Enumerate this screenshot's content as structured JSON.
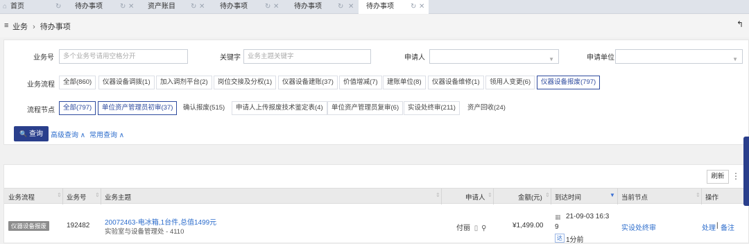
{
  "tabs": [
    {
      "label": "首页",
      "active": false
    },
    {
      "label": "待办事项",
      "active": false
    },
    {
      "label": "资产账目",
      "active": false
    },
    {
      "label": "待办事项",
      "active": false
    },
    {
      "label": "待办事项",
      "active": false
    },
    {
      "label": "待办事项",
      "active": true
    }
  ],
  "breadcrumb": {
    "menu_icon": "≡",
    "root": "业务",
    "separator": "›",
    "current": "待办事项",
    "back_icon": "↰"
  },
  "filters": {
    "business_no": {
      "label": "业务号",
      "placeholder": "多个业务号请用空格分开"
    },
    "keyword": {
      "label": "关键字",
      "placeholder": "业务主题关键字"
    },
    "applicant": {
      "label": "申请人",
      "value": ""
    },
    "unit": {
      "label": "申请单位",
      "value": ""
    }
  },
  "process": {
    "label": "业务流程",
    "chips": [
      "全部(860)",
      "仪器设备调拨(1)",
      "加入调剂平台(2)",
      "岗位交接及分权(1)",
      "仪器设备建账(37)",
      "价值增减(7)",
      "建账单位(8)",
      "仪器设备维修(1)",
      "领用人变更(6)",
      "仪器设备报废(797)"
    ],
    "selected": 9
  },
  "nodes": {
    "label": "流程节点",
    "chips": [
      "全部(797)",
      "单位资产管理员初审(37)",
      "确认报废(515)",
      "申请人上传报废技术鉴定表(4)",
      "单位资产管理员复审(6)",
      "实设处终审(211)",
      "资产回收(24)"
    ],
    "selected": [
      0,
      1
    ]
  },
  "actions": {
    "query": "查询",
    "query_icon": "🔍",
    "advanced": "高级查询 ∧",
    "common": "常用查询 ∧"
  },
  "table": {
    "refresh": "刷新",
    "headers": [
      "业务流程",
      "业务号",
      "业务主题",
      "申请人",
      "金额(元)",
      "到达时间",
      "当前节点",
      "操作"
    ],
    "rows": [
      {
        "flow": "仪器设备报废",
        "no": "192482",
        "title": "20072463-电冰箱,1台件,总值1499元",
        "subtitle": "实验室与设备管理处 - 4110",
        "applicant": "付丽",
        "amount": "¥1,499.00",
        "time1": "21-09-03 16:3",
        "time2": "9",
        "elapsed": "1分前",
        "node": "实设处终审",
        "op_handle": "处理",
        "op_note": "备注"
      }
    ]
  }
}
